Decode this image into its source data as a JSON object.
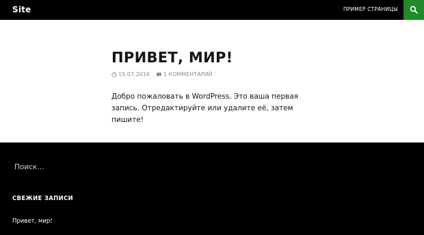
{
  "header": {
    "site_title": "Site",
    "nav_link": "ПРИМЕР СТРАНИЦЫ",
    "search_icon": "search-icon",
    "accent_color": "#1f8b2a"
  },
  "post": {
    "title": "ПРИВЕТ, МИР!",
    "date": "15.07.2016",
    "comments": "1 КОММЕНТАРИЙ",
    "body": "Добро пожаловать в WordPress. Это ваша первая запись. Отредактируйте или удалите её, затем пишите!"
  },
  "footer": {
    "search_placeholder": "Поиск…",
    "widget_title": "СВЕЖИЕ ЗАПИСИ",
    "recent_posts": [
      "Привет, мир!"
    ]
  }
}
